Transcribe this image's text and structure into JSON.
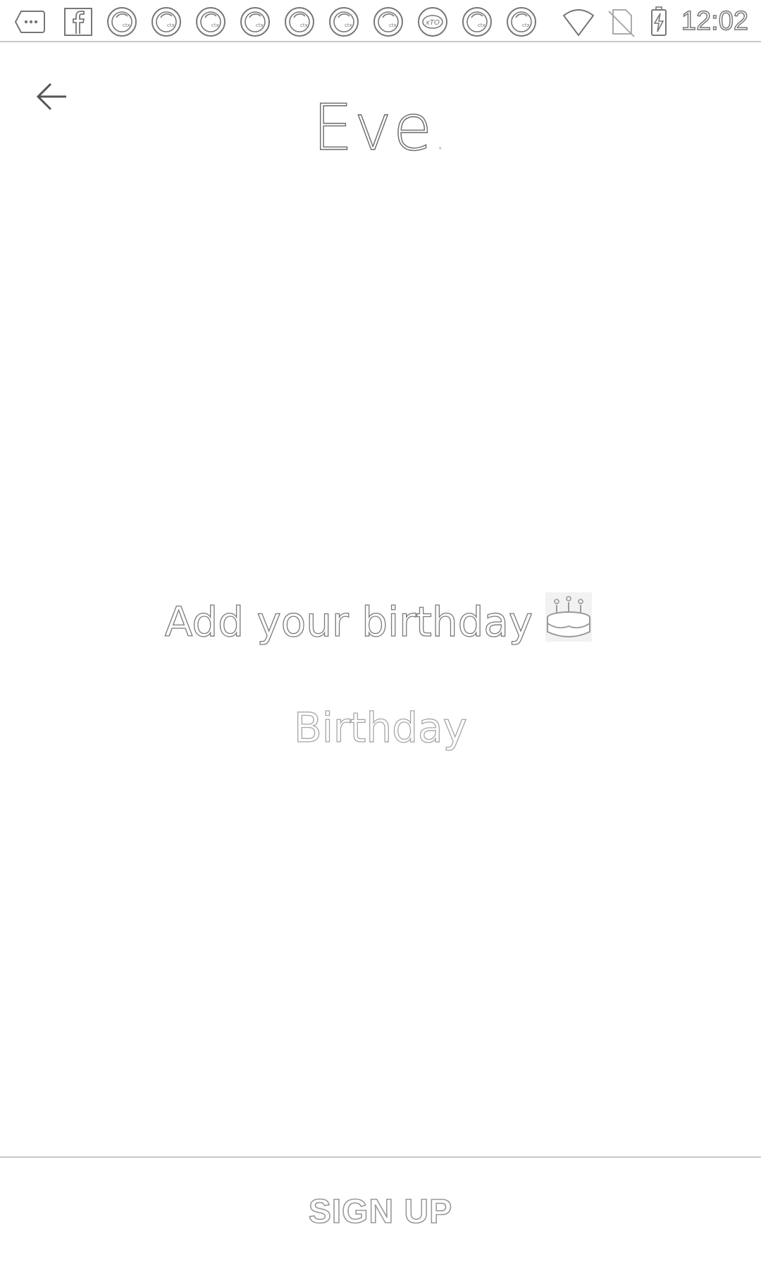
{
  "status_bar": {
    "time": "12:02",
    "icons": [
      "more-notifications-icon",
      "facebook-icon",
      "app-notification-icon",
      "app-notification-icon",
      "app-notification-icon",
      "app-notification-icon",
      "app-notification-icon",
      "app-notification-icon",
      "app-notification-icon",
      "app-notification-icon-alt",
      "app-notification-icon",
      "app-notification-icon",
      "wifi-icon",
      "no-sim-icon",
      "battery-charging-icon"
    ]
  },
  "header": {
    "back_icon": "arrow-back-icon",
    "brand": "Eve",
    "brand_dot": "."
  },
  "main": {
    "prompt": "Add your birthday",
    "prompt_icon": "birthday-cake-icon",
    "birthday_placeholder": "Birthday",
    "birthday_value": ""
  },
  "footer": {
    "signup_label": "SIGN UP"
  }
}
